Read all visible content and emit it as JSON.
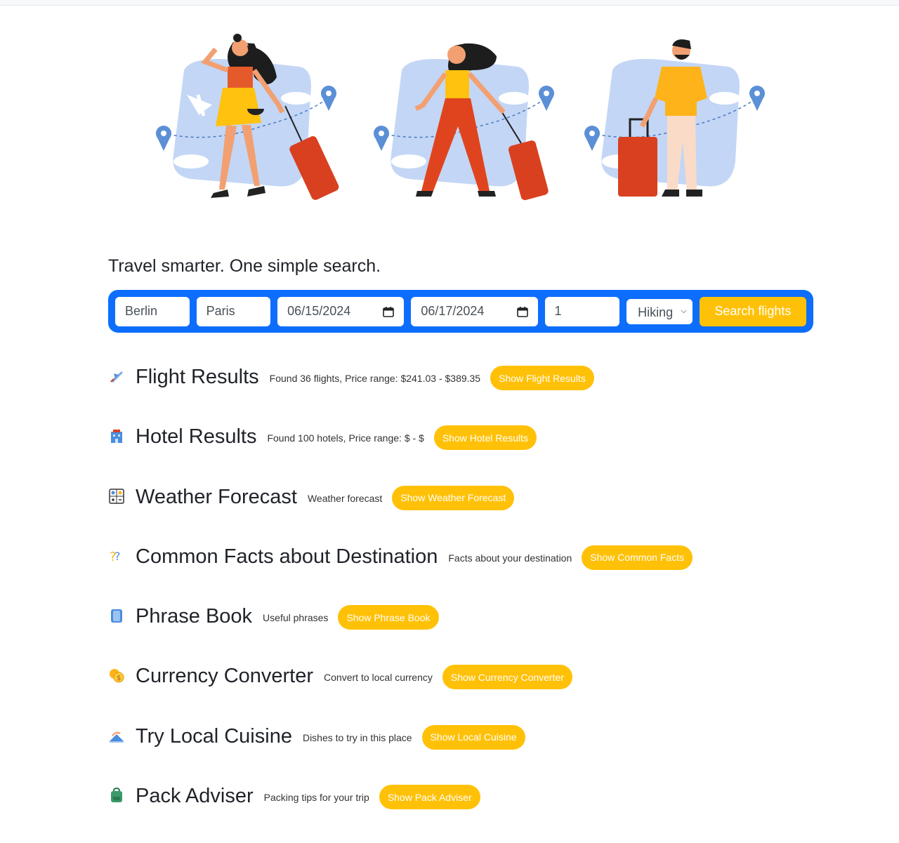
{
  "hero": {
    "illustrations": [
      "traveler-woman-shorts",
      "traveler-woman-trousers",
      "traveler-man-suitcase"
    ]
  },
  "tagline": "Travel smarter. One simple search.",
  "search": {
    "origin": "Berlin",
    "destination": "Paris",
    "depart_date": "06/15/2024",
    "return_date": "06/17/2024",
    "travelers": "1",
    "activity": "Hiking",
    "button_label": "Search flights"
  },
  "sections": [
    {
      "icon": "airplane-icon",
      "title": "Flight Results",
      "description": "Found 36 flights, Price range: $241.03 - $389.35",
      "button": "Show Flight Results"
    },
    {
      "icon": "hotel-icon",
      "title": "Hotel Results",
      "description": "Found 100 hotels, Price range: $ - $",
      "button": "Show Hotel Results"
    },
    {
      "icon": "weather-icon",
      "title": "Weather Forecast",
      "description": "Weather forecast",
      "button": "Show Weather Forecast"
    },
    {
      "icon": "question-icon",
      "title": "Common Facts about Destination",
      "description": "Facts about your destination",
      "button": "Show Common Facts"
    },
    {
      "icon": "phrasebook-icon",
      "title": "Phrase Book",
      "description": "Useful phrases",
      "button": "Show Phrase Book"
    },
    {
      "icon": "coins-icon",
      "title": "Currency Converter",
      "description": "Convert to local currency",
      "button": "Show Currency Converter"
    },
    {
      "icon": "cuisine-icon",
      "title": "Try Local Cuisine",
      "description": "Dishes to try in this place",
      "button": "Show Local Cuisine"
    },
    {
      "icon": "backpack-icon",
      "title": "Pack Adviser",
      "description": "Packing tips for your trip",
      "button": "Show Pack Adviser"
    }
  ],
  "colors": {
    "primary": "#0d6efd",
    "accent": "#ffc107",
    "illustration_bg": "#c3d6f5",
    "suitcase": "#d9401f"
  }
}
